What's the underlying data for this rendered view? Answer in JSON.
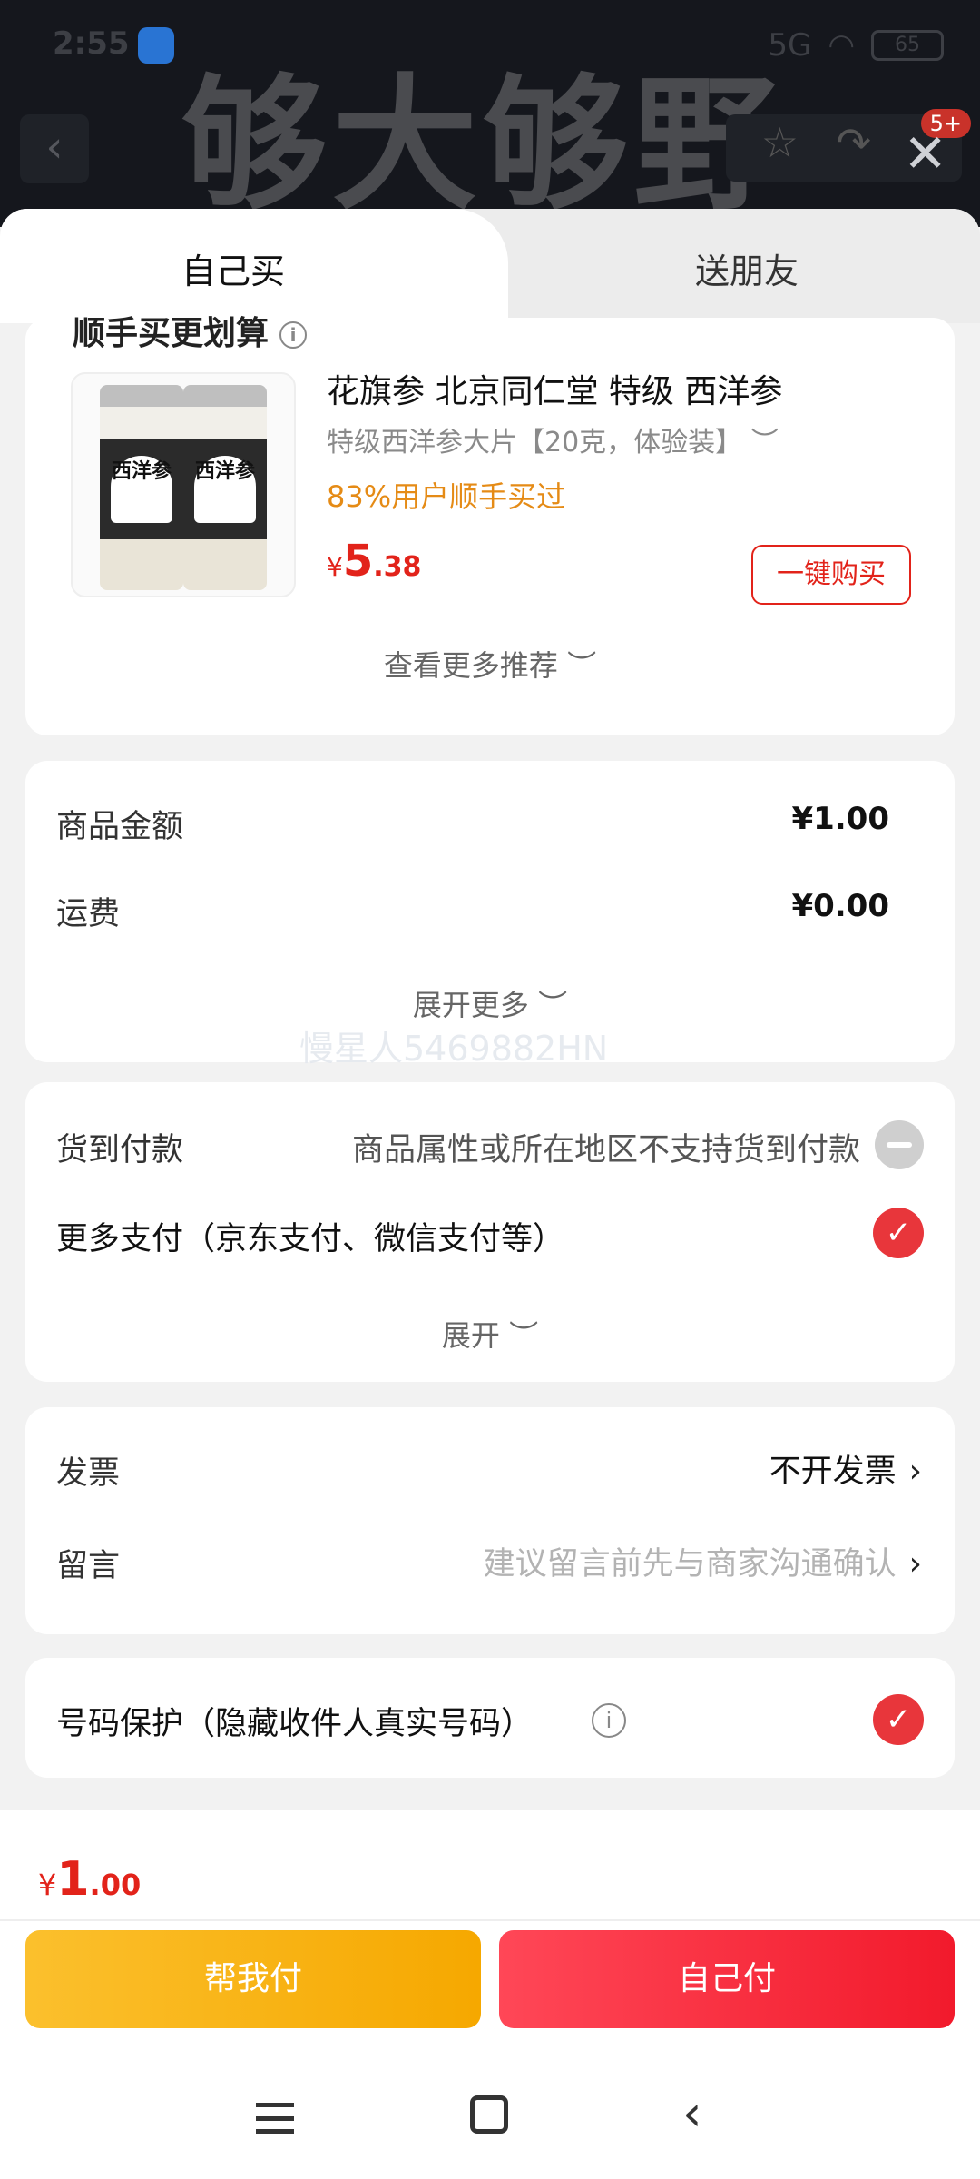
{
  "status_bar": {
    "time": "2:55",
    "signal": "5G",
    "battery": "65"
  },
  "backdrop": {
    "banner_text": "够大够野",
    "back_glyph": "‹",
    "badge": "5+",
    "close_glyph": "✕"
  },
  "tabs": {
    "self_buy": "自己买",
    "gift_friend": "送朋友"
  },
  "recommend": {
    "heading": "顺手买更划算",
    "product_title": "花旗参 北京同仁堂 特级 西洋参",
    "spec": "特级西洋参大片【20克，体验装】 ︶",
    "social_proof": "83%用户顺手买过",
    "price_currency": "¥",
    "price_int": "5",
    "price_dec": ".38",
    "buy_label": "一键购买",
    "jar_label": "西洋参",
    "see_more": "查看更多推荐 ︶"
  },
  "amount": {
    "goods_label": "商品金额",
    "goods_value": "¥1.00",
    "shipping_label": "运费",
    "shipping_value": "¥0.00",
    "expand_label": "展开更多 ︶"
  },
  "payment": {
    "cod_label": "货到付款",
    "cod_note": "商品属性或所在地区不支持货到付款",
    "more_label": "更多支付（京东支付、微信支付等）",
    "expand_label": "展开 ︶"
  },
  "invoice": {
    "invoice_label": "发票",
    "invoice_value": "不开发票",
    "message_label": "留言",
    "message_placeholder": "建议留言前先与商家沟通确认",
    "chevron": "›"
  },
  "privacy": {
    "label": "号码保护（隐藏收件人真实号码）",
    "info_glyph": "i"
  },
  "watermark": "慢星人5469882HN",
  "footer": {
    "total_currency": "¥",
    "total_int": "1",
    "total_dec": ".00",
    "help_pay": "帮我付",
    "self_pay": "自己付"
  },
  "colors": {
    "accent_red": "#e2231a",
    "social_orange": "#e58b16",
    "help_yellow": "#fbc02d"
  }
}
